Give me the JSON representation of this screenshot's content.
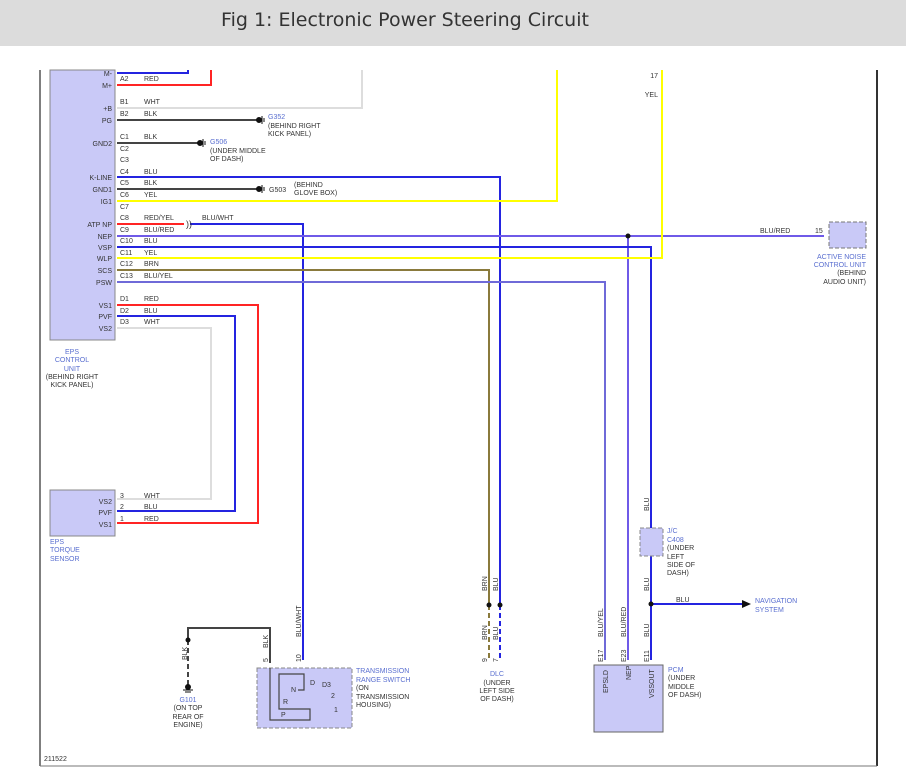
{
  "title": "Fig 1: Electronic Power Steering Circuit",
  "colors": {
    "blue": "#2424e0",
    "red": "#ff2424",
    "yellow": "#ffff00",
    "brown": "#8a7a3c",
    "white": "#dddddd",
    "black": "#444444",
    "blue_red": "#6f5ae8",
    "module_fill": "#c9c9f7"
  },
  "eps_unit": {
    "name": [
      "EPS",
      "CONTROL",
      "UNIT"
    ],
    "location": [
      "(BEHIND RIGHT",
      "KICK PANEL)"
    ],
    "terminals": [
      "M-",
      "M+",
      "+B",
      "PG",
      "GND2",
      "K-LINE",
      "GND1",
      "IG1",
      "ATP NP",
      "NEP",
      "VSP",
      "WLP",
      "SCS",
      "PSW",
      "VS1",
      "PVF",
      "VS2"
    ],
    "codes": [
      "A2",
      "B1",
      "B2",
      "C1",
      "C2",
      "C3",
      "C4",
      "C5",
      "C6",
      "C7",
      "C8",
      "C9",
      "C10",
      "C11",
      "C12",
      "C13",
      "D1",
      "D2",
      "D3"
    ],
    "wires": [
      "RED",
      "WHT",
      "BLK",
      "BLK",
      "BLU",
      "BLK",
      "YEL",
      "RED/YEL",
      "BLU/RED",
      "BLU",
      "YEL",
      "BRN",
      "BLU/YEL",
      "RED",
      "BLU",
      "WHT"
    ],
    "atp_splice_wire": "BLU/WHT"
  },
  "grounds": {
    "g352": {
      "name": "G352",
      "location": [
        "(BEHIND RIGHT",
        "KICK PANEL)"
      ]
    },
    "g506": {
      "name": "G506",
      "location": [
        "(UNDER MIDDLE",
        "OF DASH)"
      ]
    },
    "g503": {
      "name": "G503",
      "location": [
        "(BEHIND",
        "GLOVE BOX)"
      ]
    },
    "g101": {
      "name": "G101",
      "location": [
        "(ON TOP",
        "REAR OF",
        "ENGINE)"
      ],
      "wire": "BLK"
    }
  },
  "torque_sensor": {
    "name": [
      "EPS",
      "TORQUE",
      "SENSOR"
    ],
    "terminals": [
      "VS2",
      "PVF",
      "VS1"
    ],
    "codes": [
      "3",
      "2",
      "1"
    ],
    "wires": [
      "WHT",
      "BLU",
      "RED"
    ]
  },
  "wlp_branch": {
    "pin": "17",
    "wire": "YEL"
  },
  "anc": {
    "name": [
      "ACTIVE NOISE",
      "CONTROL UNIT"
    ],
    "location": [
      "(BEHIND",
      "AUDIO UNIT)"
    ],
    "pin": "15",
    "wire": "BLU/RED"
  },
  "trans_switch": {
    "name": [
      "TRANSMISSION",
      "RANGE SWITCH"
    ],
    "location": [
      "(ON",
      "TRANSMISSION",
      "HOUSING)"
    ],
    "pins": [
      "5",
      "10"
    ],
    "wires": [
      "BLK",
      "BLU/WHT"
    ],
    "positions": [
      "P",
      "R",
      "N",
      "D",
      "D3",
      "2",
      "1"
    ]
  },
  "dlc": {
    "name": "DLC",
    "location": [
      "(UNDER",
      "LEFT SIDE",
      "OF DASH)"
    ],
    "pins": [
      "9",
      "7"
    ],
    "wires": [
      "BRN",
      "BLU"
    ]
  },
  "jc": {
    "name": [
      "J/C",
      "C408"
    ],
    "location": [
      "(UNDER",
      "LEFT",
      "SIDE OF",
      "DASH)"
    ],
    "wire": "BLU"
  },
  "nav": {
    "name": [
      "NAVIGATION",
      "SYSTEM"
    ],
    "wire": "BLU"
  },
  "pcm": {
    "name": "PCM",
    "location": [
      "(UNDER",
      "MIDDLE",
      "OF DASH)"
    ],
    "pins": [
      "E17",
      "E23",
      "E11"
    ],
    "terminals": [
      "EPSLD",
      "NEP",
      "VSSOUT"
    ],
    "wires": [
      "BLU/YEL",
      "BLU/RED",
      "BLU"
    ]
  },
  "figure_id": "211522"
}
